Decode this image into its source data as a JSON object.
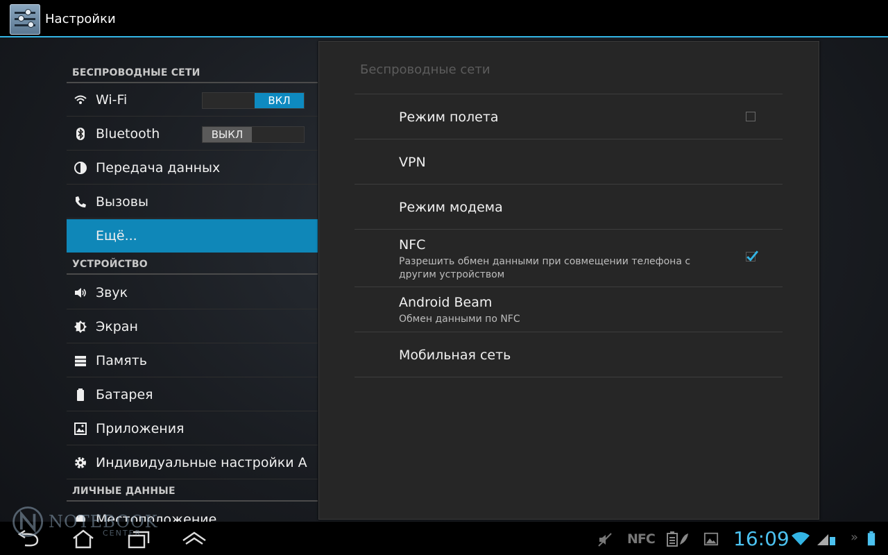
{
  "app": {
    "title": "Настройки"
  },
  "sidebar": {
    "sections": [
      {
        "header": "БЕСПРОВОДНЫЕ СЕТИ"
      },
      {
        "header": "УСТРОЙСТВО"
      },
      {
        "header": "ЛИЧНЫЕ ДАННЫЕ"
      }
    ],
    "items": [
      {
        "label": "Wi-Fi",
        "icon": "wifi-icon",
        "toggle": "ВКЛ"
      },
      {
        "label": "Bluetooth",
        "icon": "bluetooth-icon",
        "toggle": "ВЫКЛ"
      },
      {
        "label": "Передача данных",
        "icon": "data-usage-icon"
      },
      {
        "label": "Вызовы",
        "icon": "phone-icon"
      },
      {
        "label": "Ещё...",
        "icon": "",
        "selected": true
      },
      {
        "label": "Звук",
        "icon": "speaker-icon"
      },
      {
        "label": "Экран",
        "icon": "brightness-icon"
      },
      {
        "label": "Память",
        "icon": "storage-icon"
      },
      {
        "label": "Батарея",
        "icon": "battery-icon"
      },
      {
        "label": "Приложения",
        "icon": "apps-icon"
      },
      {
        "label": "Индивидуальные настройки А",
        "icon": "gear-icon"
      },
      {
        "label": "Местоположение",
        "icon": "location-icon"
      }
    ]
  },
  "panel": {
    "title": "Беспроводные сети",
    "rows": [
      {
        "title": "Режим полета",
        "checkbox": false
      },
      {
        "title": "VPN"
      },
      {
        "title": "Режим модема"
      },
      {
        "title": "NFC",
        "subtitle": "Разрешить обмен данными при совмещении телефона с другим устройством",
        "checkbox": true
      },
      {
        "title": "Android Beam",
        "subtitle": "Обмен данными по NFC"
      },
      {
        "title": "Мобильная сеть"
      }
    ]
  },
  "statusbar": {
    "time": "16:09",
    "icons": [
      "mute-icon",
      "nfc-icon",
      "battery-saver-icon",
      "image-icon",
      "wifi-icon",
      "signal-icon",
      "battery-icon"
    ],
    "nfc_label": "NFC"
  },
  "watermark": {
    "text": "NOTEBOOK",
    "sub": "CENTER"
  },
  "colors": {
    "accent": "#33b5e5",
    "selected": "#0f87b8",
    "clock": "#4cc2f0"
  }
}
